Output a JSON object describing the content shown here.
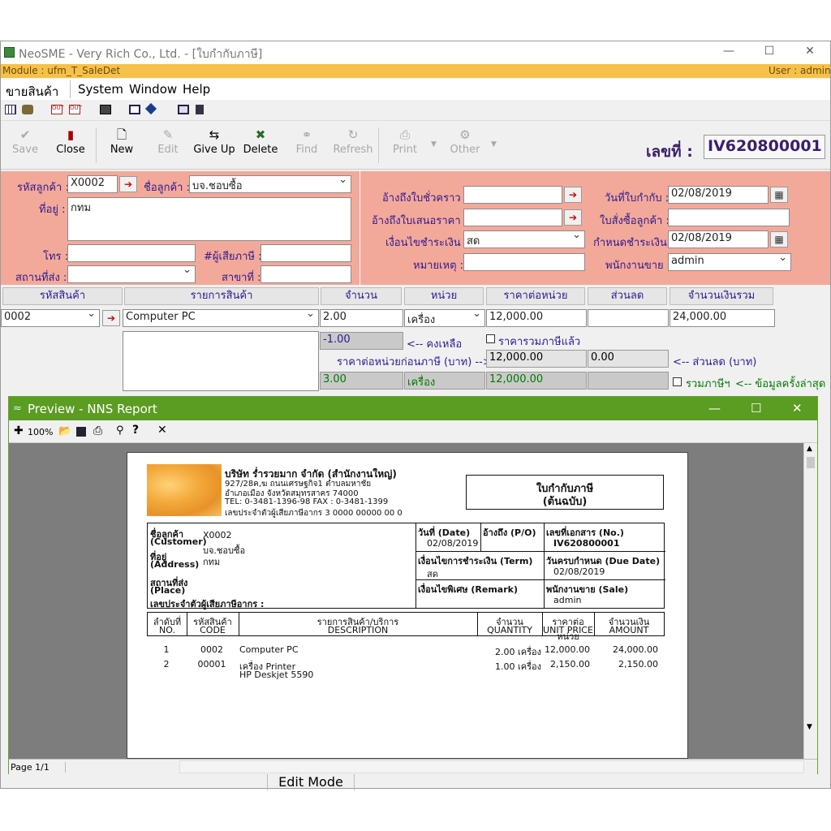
{
  "window": {
    "title": "NeoSME - Very Rich Co., Ltd. - [ใบกำกับภาษี]",
    "module": "Module  : ufm_T_SaleDet",
    "user": "User : admin"
  },
  "menu": [
    "ขายสินค้า",
    "System",
    "Window",
    "Help"
  ],
  "toolbar": {
    "save": "Save",
    "close": "Close",
    "new": "New",
    "edit": "Edit",
    "give_up": "Give Up",
    "delete": "Delete",
    "find": "Find",
    "refresh": "Refresh",
    "print": "Print",
    "other": "Other"
  },
  "doc": {
    "label": "เลขที่ :",
    "number": "IV620800001"
  },
  "header": {
    "customer_code_label": "รหัสลูกค้า :",
    "customer_code": "X0002",
    "customer_name_label": "ชื่อลูกค้า :",
    "customer_name": "บจ.ชอบซื้อ",
    "address_label": "ที่อยู่ :",
    "address": "กทม",
    "phone_label": "โทร :",
    "phone": "",
    "taxid_label": "#ผู้เสียภาษี :",
    "taxid": "",
    "place_label": "สถานที่ส่ง :",
    "place": "",
    "branch_label": "สาขาที่ :",
    "branch": "",
    "ref_temp_label": "อ้างถึงใบชั่วคราว :",
    "ref_temp": "",
    "ref_quote_label": "อ้างถึงใบเสนอราคา :",
    "ref_quote": "",
    "term_label": "เงื่อนไขชำระเงิน :",
    "term": "สด",
    "remark_label": "หมายเหตุ :",
    "remark": "",
    "date_label": "วันที่ใบกำกับ :",
    "date": "02/08/2019",
    "po_label": "ใบสั่งซื้อลูกค้า :",
    "po": "",
    "due_label": "กำหนดชำระเงิน :",
    "due": "02/08/2019",
    "sale_label": "พนักงานขาย :",
    "sale": "admin"
  },
  "grid": {
    "headers": [
      "รหัสสินค้า",
      "รายการสินค้า",
      "จำนวน",
      "หน่วย",
      "ราคาต่อหน่วย",
      "ส่วนลด",
      "จำนวนเงินรวม"
    ],
    "row": {
      "code": "0002",
      "desc": "Computer PC",
      "qty": "2.00",
      "unit": "เครื่อง",
      "price": "12,000.00",
      "discount": "",
      "amount": "24,000.00"
    },
    "remaining_value": "-1.00",
    "remaining_label": "<-- คงเหลือ",
    "vat_incl_label": "ราคารวมภาษีแล้ว",
    "pre_tax_label": "ราคาต่อหน่วยก่อนภาษี (บาท) -->",
    "pre_tax_price": "12,000.00",
    "pre_tax_discount": "0.00",
    "discount_label": "<-- ส่วนลด (บาท)",
    "last_qty": "3.00",
    "last_unit": "เครื่อง",
    "last_price": "12,000.00",
    "vat_label": "รวมภาษีฯ",
    "last_label": "<-- ข้อมูลครั้งล่าสุด"
  },
  "status_mode": "Edit Mode",
  "preview": {
    "title": "Preview - NNS Report",
    "zoom": "100%",
    "page": "Page 1/1",
    "report": {
      "company": "บริษัท ร่ำรวยมาก จำกัด (สำนักงานใหญ่)",
      "addr1": "927/28ค,ฆ ถนนเศรษฐกิจ1 ตำบลมหาชัย",
      "addr2": "อำเภอเมือง จังหวัดสมุทรสาคร 74000",
      "tel": "TEL: 0-3481-1396-98  FAX : 0-3481-1399",
      "taxno": "เลขประจำตัวผู้เสียภาษีอากร  3 0000 00000 00 0",
      "doc_title": "ใบกำกับภาษี",
      "doc_subtitle": "(ต้นฉบับ)",
      "cust_label": "ชื่อลูกค้า",
      "cust_label_en": "(Customer)",
      "cust_code": "X0002",
      "cust_name": "บจ.ชอบซื้อ",
      "addr_label": "ที่อยู่",
      "addr_label_en": "(Address)",
      "addr_val": "กทม",
      "place_label": "สถานที่ส่ง",
      "place_label_en": "(Place)",
      "taxid_label": "เลขประจำตัวผู้เสียภาษีอากร :",
      "date_label": "วันที่ (Date)",
      "date_val": "02/08/2019",
      "po_label": "อ้างถึง (P/O)",
      "no_label": "เลขที่เอกสาร (No.)",
      "no_val": "IV620800001",
      "term_label": "เงื่อนไขการชำระเงิน (Term)",
      "term_val": "สด",
      "due_label": "วันครบกำหนด (Due Date)",
      "due_val": "02/08/2019",
      "remark_label": "เงื่อนไขพิเศษ (Remark)",
      "sale_label": "พนักงานขาย (Sale)",
      "sale_val": "admin",
      "cols": [
        {
          "th": "ลำดับที่",
          "en": "NO."
        },
        {
          "th": "รหัสสินค้า",
          "en": "CODE"
        },
        {
          "th": "รายการสินค้า/บริการ",
          "en": "DESCRIPTION"
        },
        {
          "th": "จำนวน",
          "en": "QUANTITY"
        },
        {
          "th": "ราคาต่อหน่วย",
          "en": "UNIT PRICE"
        },
        {
          "th": "จำนวนเงิน",
          "en": "AMOUNT"
        }
      ],
      "items": [
        {
          "no": "1",
          "code": "0002",
          "desc": "Computer PC",
          "desc2": "",
          "qty": "2.00 เครื่อง",
          "price": "12,000.00",
          "amount": "24,000.00"
        },
        {
          "no": "2",
          "code": "00001",
          "desc": "เครื่อง Printer",
          "desc2": "HP Deskjet 5590",
          "qty": "1.00 เครื่อง",
          "price": "2,150.00",
          "amount": "2,150.00"
        }
      ]
    }
  },
  "colors": {
    "accent_bar": "#f6c14a",
    "header_panel": "#f3a99a",
    "preview_title": "#5b9c22",
    "label_text": "#2d1a8e"
  }
}
